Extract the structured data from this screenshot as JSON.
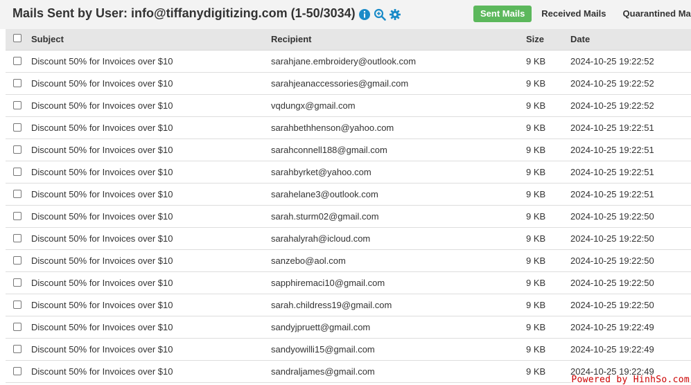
{
  "header": {
    "title": "Mails Sent by User: info@tiffanydigitizing.com (1-50/3034)",
    "icons": [
      "info-icon",
      "search-zoom-icon",
      "gear-icon"
    ],
    "accent_color": "#1a8bc8"
  },
  "tabs": [
    {
      "label": "Sent Mails",
      "active": true,
      "color": "#5cb85c"
    },
    {
      "label": "Received Mails",
      "active": false
    },
    {
      "label": "Quarantined Mai",
      "active": false
    }
  ],
  "table": {
    "columns": [
      "Subject",
      "Recipient",
      "Size",
      "Date"
    ],
    "rows": [
      {
        "subject": "Discount 50% for Invoices over $10",
        "recipient": "sarahjane.embroidery@outlook.com",
        "size": "9 KB",
        "date": "2024-10-25 19:22:52"
      },
      {
        "subject": "Discount 50% for Invoices over $10",
        "recipient": "sarahjeanaccessories@gmail.com",
        "size": "9 KB",
        "date": "2024-10-25 19:22:52"
      },
      {
        "subject": "Discount 50% for Invoices over $10",
        "recipient": "vqdungx@gmail.com",
        "size": "9 KB",
        "date": "2024-10-25 19:22:52"
      },
      {
        "subject": "Discount 50% for Invoices over $10",
        "recipient": "sarahbethhenson@yahoo.com",
        "size": "9 KB",
        "date": "2024-10-25 19:22:51"
      },
      {
        "subject": "Discount 50% for Invoices over $10",
        "recipient": "sarahconnell188@gmail.com",
        "size": "9 KB",
        "date": "2024-10-25 19:22:51"
      },
      {
        "subject": "Discount 50% for Invoices over $10",
        "recipient": "sarahbyrket@yahoo.com",
        "size": "9 KB",
        "date": "2024-10-25 19:22:51"
      },
      {
        "subject": "Discount 50% for Invoices over $10",
        "recipient": "sarahelane3@outlook.com",
        "size": "9 KB",
        "date": "2024-10-25 19:22:51"
      },
      {
        "subject": "Discount 50% for Invoices over $10",
        "recipient": "sarah.sturm02@gmail.com",
        "size": "9 KB",
        "date": "2024-10-25 19:22:50"
      },
      {
        "subject": "Discount 50% for Invoices over $10",
        "recipient": "sarahalyrah@icloud.com",
        "size": "9 KB",
        "date": "2024-10-25 19:22:50"
      },
      {
        "subject": "Discount 50% for Invoices over $10",
        "recipient": "sanzebo@aol.com",
        "size": "9 KB",
        "date": "2024-10-25 19:22:50"
      },
      {
        "subject": "Discount 50% for Invoices over $10",
        "recipient": "sapphiremaci10@gmail.com",
        "size": "9 KB",
        "date": "2024-10-25 19:22:50"
      },
      {
        "subject": "Discount 50% for Invoices over $10",
        "recipient": "sarah.childress19@gmail.com",
        "size": "9 KB",
        "date": "2024-10-25 19:22:50"
      },
      {
        "subject": "Discount 50% for Invoices over $10",
        "recipient": "sandyjpruett@gmail.com",
        "size": "9 KB",
        "date": "2024-10-25 19:22:49"
      },
      {
        "subject": "Discount 50% for Invoices over $10",
        "recipient": "sandyowilli15@gmail.com",
        "size": "9 KB",
        "date": "2024-10-25 19:22:49"
      },
      {
        "subject": "Discount 50% for Invoices over $10",
        "recipient": "sandraljames@gmail.com",
        "size": "9 KB",
        "date": "2024-10-25 19:22:49"
      }
    ]
  },
  "watermark": "Powered by HinhSo.com"
}
